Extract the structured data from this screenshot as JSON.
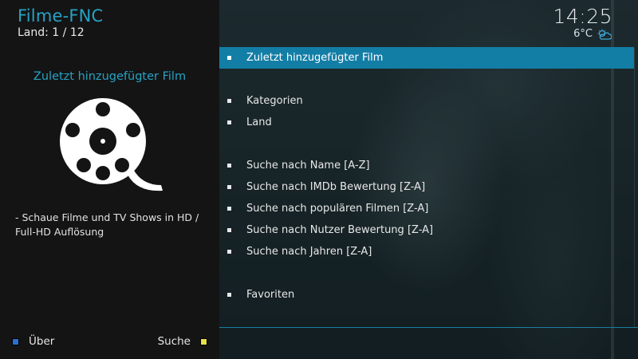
{
  "header": {
    "app_title": "Filme-FNC",
    "subtitle": "Land: 1 / 12"
  },
  "left_panel": {
    "item_heading": "Zuletzt hinzugefügter Film",
    "icon": "film-reel-icon",
    "description": "- Schaue Filme und TV Shows in HD / Full-HD Auflösung"
  },
  "footer": {
    "about_label": "Über",
    "search_label": "Suche"
  },
  "status": {
    "time": "14:25",
    "temperature": "6°C",
    "weather_icon": "partly-cloudy-icon"
  },
  "menu": {
    "items": [
      {
        "label": "Zuletzt hinzugefügter Film",
        "selected": true
      },
      {
        "label": "Kategorien"
      },
      {
        "label": "Land"
      },
      {
        "label": "Suche nach Name [A-Z]"
      },
      {
        "label": "Suche nach IMDb Bewertung [Z-A]"
      },
      {
        "label": "Suche nach populären Filmen [Z-A]"
      },
      {
        "label": "Suche nach Nutzer Bewertung [Z-A]"
      },
      {
        "label": "Suche nach Jahren [Z-A]"
      },
      {
        "label": "Favoriten"
      }
    ]
  },
  "colors": {
    "accent": "#25a3c4",
    "selection": "#137ea5",
    "panel": "#141414"
  }
}
